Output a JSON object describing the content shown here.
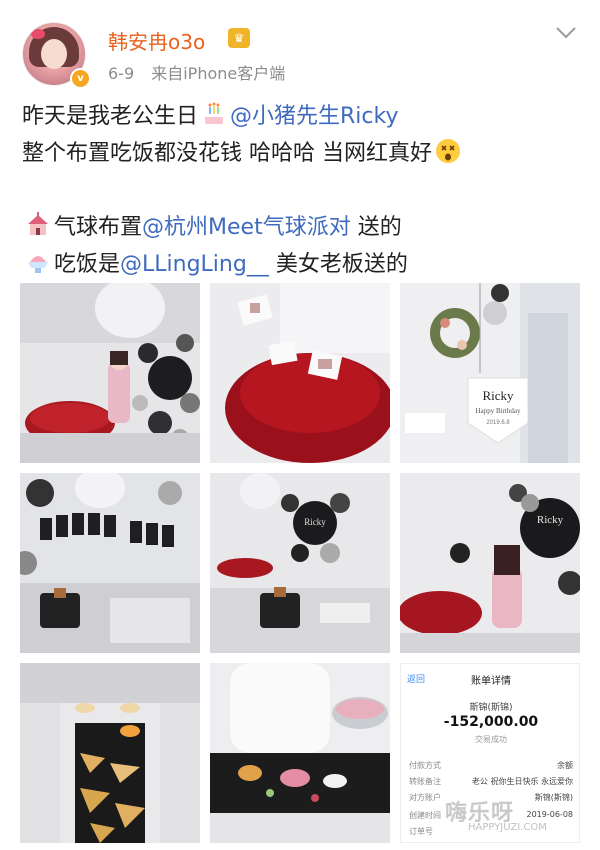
{
  "header": {
    "username": "韩安冉o3o",
    "date": "6-9",
    "source": "来自iPhone客户端"
  },
  "post": {
    "line1_text": "昨天是我老公生日",
    "line1_mention": "@小猪先生Ricky",
    "line2_text": "整个布置吃饭都没花钱 哈哈哈 当网红真好",
    "line3_prefix": "气球布置",
    "line3_mention": "@杭州Meet气球派对",
    "line3_suffix": " 送的",
    "line4_prefix": "吃饭是",
    "line4_mention": "@LLingLing__",
    "line4_suffix": " 美女老板送的"
  },
  "photos": {
    "sign_text_1": "Ricky",
    "sign_text_2": "Ricky",
    "sign_sub": "Happy Birthday",
    "sign_date": "2019.6.8"
  },
  "receipt": {
    "back_label": "返回",
    "title": "账单详情",
    "merchant": "斯锦(斯锦)",
    "amount": "-152,000.00",
    "status": "交易成功",
    "rows": [
      {
        "label": "付款方式",
        "value": "余额"
      },
      {
        "label": "转账备注",
        "value": "老公 祝你生日快乐 永远爱你"
      },
      {
        "label": "对方账户",
        "value": "斯锦(斯锦)"
      },
      {
        "label": "创建时间",
        "value": "2019-06-08"
      },
      {
        "label": "订单号",
        "value": ""
      }
    ]
  },
  "watermark": {
    "text": "嗨乐呀",
    "url": "HAPPYJUZI.COM"
  },
  "colors": {
    "username": "#e8611e",
    "mention": "#3f6bbf",
    "meta": "#8c8c8c"
  }
}
